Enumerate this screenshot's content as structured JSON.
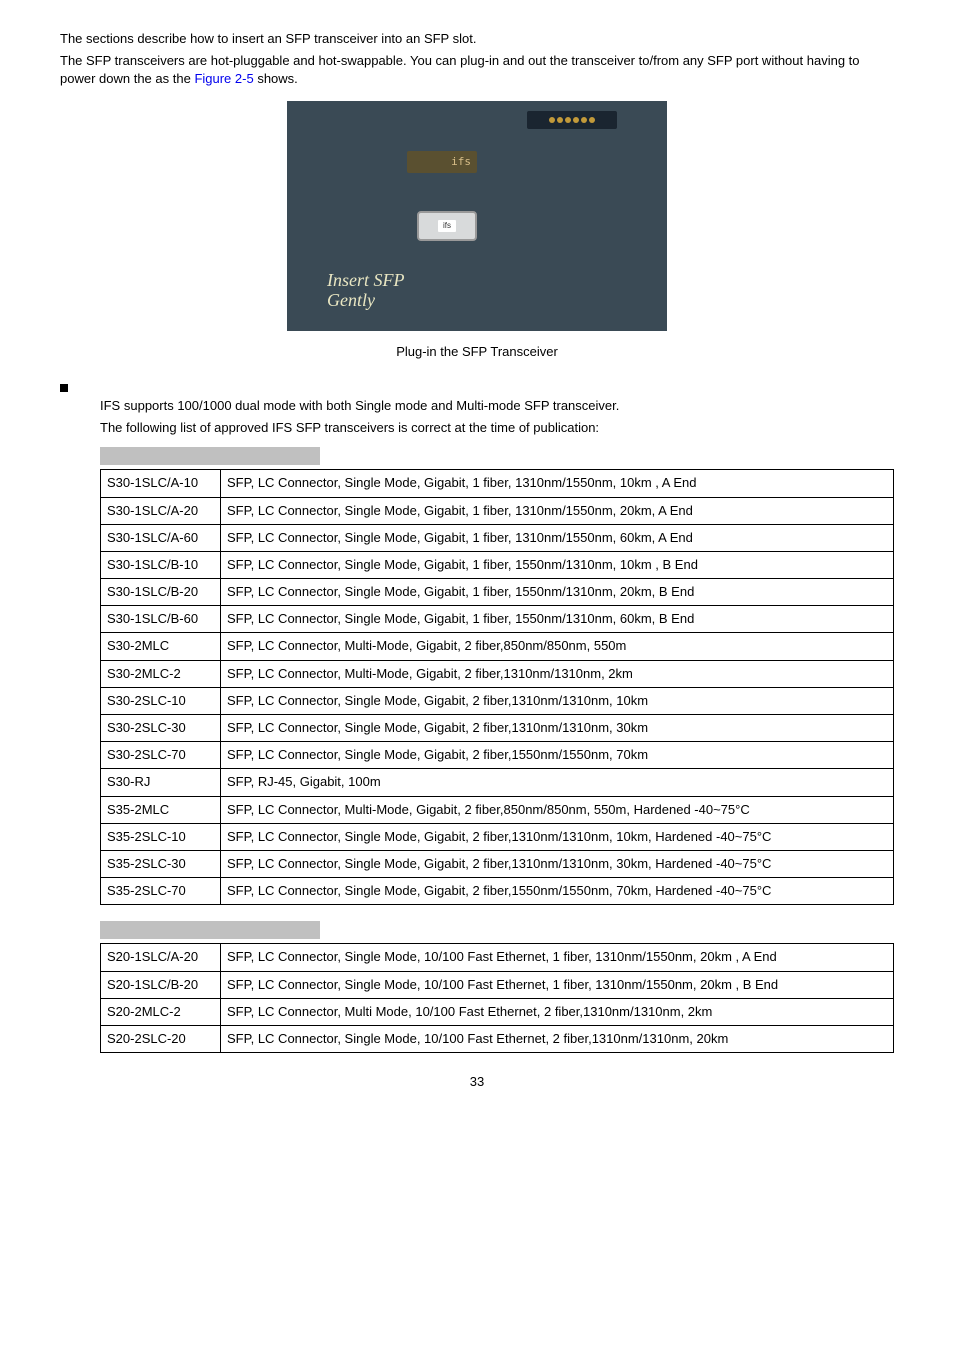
{
  "intro1": "The sections describe how to insert an SFP transceiver into an SFP slot.",
  "intro2a": "The SFP transceivers are hot-pluggable and hot-swappable. You can plug-in and out the transceiver to/from any SFP port without having to power down the ",
  "intro2b": " as the ",
  "intro2link": "Figure 2-5",
  "intro2c": " shows.",
  "ip_ifs": "ifs",
  "ip_insert": "Insert SFP",
  "ip_gently": "Gently",
  "caption": "Plug-in the SFP Transceiver",
  "ifs_label": "IFS",
  "ifs_text": " supports 100/1000 dual mode with both Single mode and Multi-mode SFP transceiver.",
  "approved_text": "The following list of approved IFS SFP transceivers is correct at the time of publication:",
  "table1": [
    [
      "S30-1SLC/A-10",
      "SFP, LC Connector, Single Mode, Gigabit,   1 fiber, 1310nm/1550nm, 10km , A End"
    ],
    [
      "S30-1SLC/A-20",
      "SFP, LC Connector, Single Mode, Gigabit,   1 fiber, 1310nm/1550nm, 20km, A End"
    ],
    [
      "S30-1SLC/A-60",
      "SFP, LC Connector, Single Mode, Gigabit,   1 fiber, 1310nm/1550nm, 60km, A End"
    ],
    [
      "S30-1SLC/B-10",
      "SFP, LC Connector, Single Mode, Gigabit,   1 fiber, 1550nm/1310nm, 10km , B End"
    ],
    [
      "S30-1SLC/B-20",
      "SFP, LC Connector, Single Mode, Gigabit,   1 fiber, 1550nm/1310nm, 20km, B End"
    ],
    [
      "S30-1SLC/B-60",
      "SFP, LC Connector, Single Mode, Gigabit,   1 fiber, 1550nm/1310nm, 60km, B End"
    ],
    [
      "S30-2MLC",
      "SFP, LC Connector, Multi-Mode, Gigabit,   2 fiber,850nm/850nm, 550m"
    ],
    [
      "S30-2MLC-2",
      "SFP, LC Connector, Multi-Mode, Gigabit,   2 fiber,1310nm/1310nm, 2km"
    ],
    [
      "S30-2SLC-10",
      "SFP, LC Connector, Single Mode, Gigabit,   2 fiber,1310nm/1310nm, 10km"
    ],
    [
      "S30-2SLC-30",
      "SFP, LC Connector, Single Mode, Gigabit,   2 fiber,1310nm/1310nm, 30km"
    ],
    [
      "S30-2SLC-70",
      "SFP, LC Connector, Single Mode, Gigabit,   2 fiber,1550nm/1550nm, 70km"
    ],
    [
      "S30-RJ",
      "SFP, RJ-45, Gigabit, 100m"
    ],
    [
      "S35-2MLC",
      "SFP, LC Connector, Multi-Mode, Gigabit,   2 fiber,850nm/850nm, 550m, Hardened -40~75°C"
    ],
    [
      "S35-2SLC-10",
      "SFP, LC Connector, Single Mode, Gigabit,   2 fiber,1310nm/1310nm, 10km, Hardened -40~75°C"
    ],
    [
      "S35-2SLC-30",
      "SFP, LC Connector, Single Mode, Gigabit,   2 fiber,1310nm/1310nm, 30km, Hardened -40~75°C"
    ],
    [
      "S35-2SLC-70",
      "SFP, LC Connector, Single Mode, Gigabit,   2 fiber,1550nm/1550nm, 70km, Hardened -40~75°C"
    ]
  ],
  "table2": [
    [
      "S20-1SLC/A-20",
      "SFP, LC Connector, Single Mode, 10/100 Fast Ethernet,   1 fiber, 1310nm/1550nm, 20km , A End"
    ],
    [
      "S20-1SLC/B-20",
      "SFP, LC Connector, Single Mode, 10/100 Fast Ethernet,   1 fiber, 1310nm/1550nm, 20km , B End"
    ],
    [
      "S20-2MLC-2",
      "SFP, LC Connector, Multi Mode, 10/100 Fast Ethernet,   2 fiber,1310nm/1310nm, 2km"
    ],
    [
      "S20-2SLC-20",
      "SFP, LC Connector, Single Mode, 10/100 Fast Ethernet,   2 fiber,1310nm/1310nm, 20km"
    ]
  ],
  "page_num": "33"
}
